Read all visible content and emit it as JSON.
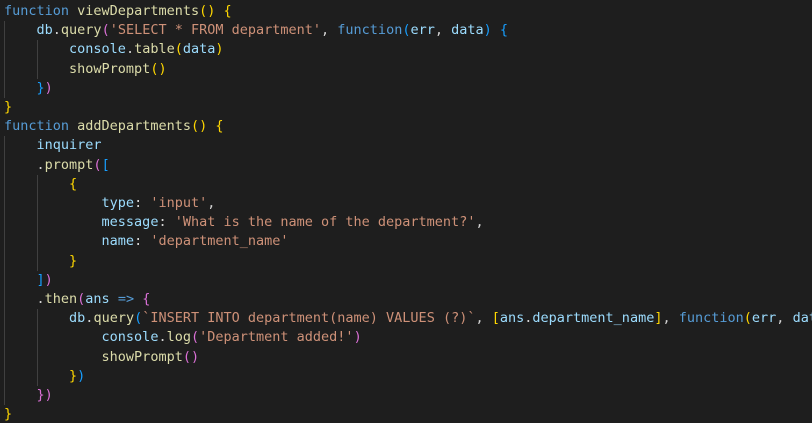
{
  "editor": {
    "theme": {
      "background": "#1e1e1e",
      "keyword": "#569cd6",
      "function_name": "#dcdcaa",
      "variable": "#9cdcfe",
      "string": "#ce9178",
      "default": "#d4d4d4",
      "bracket_level_1": "#ffd700",
      "bracket_level_2": "#da70d6",
      "bracket_level_3": "#179fff",
      "indent_guide": "#404040"
    },
    "lines": [
      [
        [
          "kw",
          "function"
        ],
        [
          "df",
          " "
        ],
        [
          "fn",
          "viewDepartments"
        ],
        [
          "b1",
          "()"
        ],
        [
          "df",
          " "
        ],
        [
          "b1",
          "{"
        ]
      ],
      [
        [
          "df",
          "    "
        ],
        [
          "var",
          "db"
        ],
        [
          "df",
          "."
        ],
        [
          "fn",
          "query"
        ],
        [
          "b2",
          "("
        ],
        [
          "str",
          "'SELECT * FROM department'"
        ],
        [
          "df",
          ", "
        ],
        [
          "kw",
          "function"
        ],
        [
          "b3",
          "("
        ],
        [
          "var",
          "err"
        ],
        [
          "df",
          ", "
        ],
        [
          "var",
          "data"
        ],
        [
          "b3",
          ")"
        ],
        [
          "df",
          " "
        ],
        [
          "b3",
          "{"
        ]
      ],
      [
        [
          "df",
          "        "
        ],
        [
          "var",
          "console"
        ],
        [
          "df",
          "."
        ],
        [
          "fn",
          "table"
        ],
        [
          "b1",
          "("
        ],
        [
          "var",
          "data"
        ],
        [
          "b1",
          ")"
        ]
      ],
      [
        [
          "df",
          "        "
        ],
        [
          "fn",
          "showPrompt"
        ],
        [
          "b1",
          "()"
        ]
      ],
      [
        [
          "df",
          "    "
        ],
        [
          "b3",
          "}"
        ],
        [
          "b2",
          ")"
        ]
      ],
      [
        [
          "b1",
          "}"
        ]
      ],
      [
        [
          "kw",
          "function"
        ],
        [
          "df",
          " "
        ],
        [
          "fn",
          "addDepartments"
        ],
        [
          "b1",
          "()"
        ],
        [
          "df",
          " "
        ],
        [
          "b1",
          "{"
        ]
      ],
      [
        [
          "df",
          "    "
        ],
        [
          "var",
          "inquirer"
        ]
      ],
      [
        [
          "df",
          "    ."
        ],
        [
          "fn",
          "prompt"
        ],
        [
          "b2",
          "("
        ],
        [
          "b3",
          "["
        ]
      ],
      [
        [
          "df",
          "        "
        ],
        [
          "b1",
          "{"
        ]
      ],
      [
        [
          "df",
          "            "
        ],
        [
          "var",
          "type"
        ],
        [
          "df",
          ": "
        ],
        [
          "str",
          "'input'"
        ],
        [
          "df",
          ","
        ]
      ],
      [
        [
          "df",
          "            "
        ],
        [
          "var",
          "message"
        ],
        [
          "df",
          ": "
        ],
        [
          "str",
          "'What is the name of the department?'"
        ],
        [
          "df",
          ","
        ]
      ],
      [
        [
          "df",
          "            "
        ],
        [
          "var",
          "name"
        ],
        [
          "df",
          ": "
        ],
        [
          "str",
          "'department_name'"
        ]
      ],
      [
        [
          "df",
          "        "
        ],
        [
          "b1",
          "}"
        ]
      ],
      [
        [
          "df",
          "    "
        ],
        [
          "b3",
          "]"
        ],
        [
          "b2",
          ")"
        ]
      ],
      [
        [
          "df",
          "    ."
        ],
        [
          "fn",
          "then"
        ],
        [
          "b2",
          "("
        ],
        [
          "var",
          "ans"
        ],
        [
          "df",
          " "
        ],
        [
          "kw",
          "=>"
        ],
        [
          "df",
          " "
        ],
        [
          "b2",
          "{"
        ]
      ],
      [
        [
          "df",
          "        "
        ],
        [
          "var",
          "db"
        ],
        [
          "df",
          "."
        ],
        [
          "fn",
          "query"
        ],
        [
          "b3",
          "("
        ],
        [
          "str",
          "`INSERT INTO department(name) VALUES (?)`"
        ],
        [
          "df",
          ", "
        ],
        [
          "b1",
          "["
        ],
        [
          "var",
          "ans"
        ],
        [
          "df",
          "."
        ],
        [
          "var",
          "department_name"
        ],
        [
          "b1",
          "]"
        ],
        [
          "df",
          ", "
        ],
        [
          "kw",
          "function"
        ],
        [
          "b1",
          "("
        ],
        [
          "var",
          "err"
        ],
        [
          "df",
          ", "
        ],
        [
          "var",
          "data"
        ],
        [
          "b1",
          ")"
        ],
        [
          "b1",
          "{"
        ]
      ],
      [
        [
          "df",
          "            "
        ],
        [
          "var",
          "console"
        ],
        [
          "df",
          "."
        ],
        [
          "fn",
          "log"
        ],
        [
          "b2",
          "("
        ],
        [
          "str",
          "'Department added!'"
        ],
        [
          "b2",
          ")"
        ]
      ],
      [
        [
          "df",
          "            "
        ],
        [
          "fn",
          "showPrompt"
        ],
        [
          "b2",
          "()"
        ]
      ],
      [
        [
          "df",
          "        "
        ],
        [
          "b1",
          "}"
        ],
        [
          "b3",
          ")"
        ]
      ],
      [
        [
          "df",
          "    "
        ],
        [
          "b2",
          "})"
        ]
      ],
      [
        [
          "b1",
          "}"
        ]
      ]
    ]
  }
}
